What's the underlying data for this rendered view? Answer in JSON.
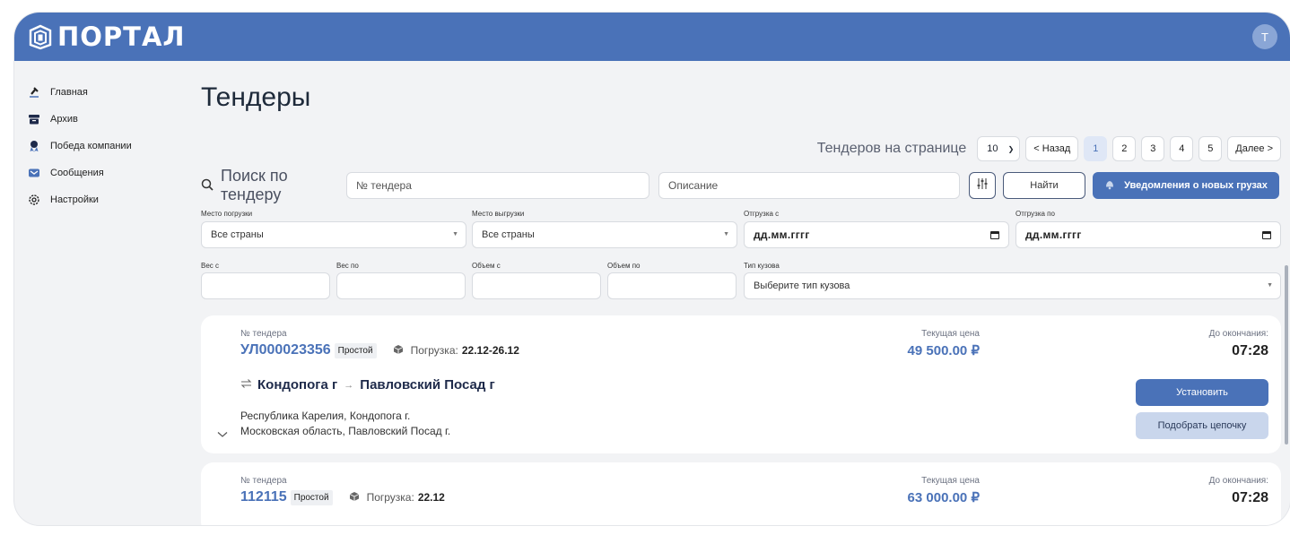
{
  "app": {
    "logo_text": "ПОРТАЛ",
    "avatar_initial": "T"
  },
  "sidebar": {
    "items": [
      {
        "label": "Главная",
        "icon": "gavel-icon"
      },
      {
        "label": "Архив",
        "icon": "archive-icon"
      },
      {
        "label": "Победа компании",
        "icon": "award-icon"
      },
      {
        "label": "Сообщения",
        "icon": "mail-icon"
      },
      {
        "label": "Настройки",
        "icon": "gear-icon"
      }
    ]
  },
  "main": {
    "title": "Тендеры"
  },
  "pagination": {
    "per_page_label": "Тендеров на странице",
    "per_page_value": "10",
    "prev_label": "< Назад",
    "pages": [
      "1",
      "2",
      "3",
      "4",
      "5"
    ],
    "active_page": "1",
    "next_label": "Далее >"
  },
  "search": {
    "label": "Поиск по тендеру",
    "tender_placeholder": "№ тендера",
    "description_placeholder": "Описание",
    "find_label": "Найти",
    "notify_label": "Уведомления о новых грузах"
  },
  "filters": {
    "loading_place_label": "Место погрузки",
    "loading_place_value": "Все страны",
    "unloading_place_label": "Место выгрузки",
    "unloading_place_value": "Все страны",
    "ship_from_label": "Отгрузка с",
    "ship_from_value": "дд.мм.гггг",
    "ship_to_label": "Отгрузка по",
    "ship_to_value": "дд.мм.гггг",
    "weight_from_label": "Вес с",
    "weight_to_label": "Вес по",
    "volume_from_label": "Объем с",
    "volume_to_label": "Объем по",
    "body_type_label": "Тип кузова",
    "body_type_placeholder": "Выберите тип кузова"
  },
  "tenders": [
    {
      "number_label": "№ тендера",
      "number": "УЛ000023356",
      "type": "Простой",
      "loading_label": "Погрузка:",
      "loading_dates": "22.12-26.12",
      "price_label": "Текущая цена",
      "price": "49 500.00 ₽",
      "deadline_label": "До окончания:",
      "deadline": "07:28",
      "route_from": "Кондопога г",
      "route_to": "Павловский Посад г",
      "address_from": "Республика Карелия, Кондопога г.",
      "address_to": "Московская область, Павловский Посад г.",
      "set_label": "Установить",
      "chain_label": "Подобрать цепочку"
    },
    {
      "number_label": "№ тендера",
      "number": "112115",
      "type": "Простой",
      "loading_label": "Погрузка:",
      "loading_dates": "22.12",
      "price_label": "Текущая цена",
      "price": "63 000.00 ₽",
      "deadline_label": "До окончания:",
      "deadline": "07:28"
    }
  ],
  "colors": {
    "brand": "#4a72b8",
    "background": "#f2f3f5"
  }
}
